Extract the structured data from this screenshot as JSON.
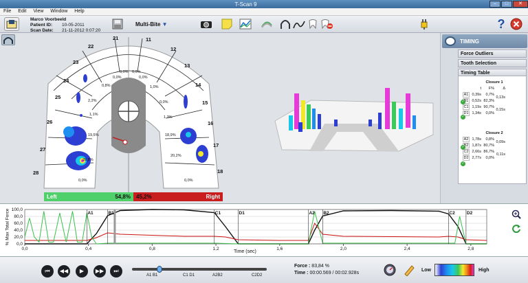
{
  "window": {
    "title": "T-Scan 9"
  },
  "menu": [
    "File",
    "Edit",
    "View",
    "Window",
    "Help"
  ],
  "patient": {
    "name": "Marco Voorbeeld",
    "id_label": "Patient ID:",
    "id": "10-05-2011",
    "date_label": "Scan Date:",
    "date": "21-11-2012 0:07:20"
  },
  "toolbar": {
    "mode": "Multi-Bite"
  },
  "panel": {
    "title": "TIMING",
    "sections": [
      "Force Outliers",
      "Tooth Selection",
      "Timing Table"
    ],
    "headers": {
      "t": "t",
      "f": "F%",
      "d": "Δ"
    },
    "closures": [
      {
        "title": "Closure 1",
        "rows": [
          {
            "id": "A1",
            "t": "0,39s",
            "f": "0,7%"
          },
          {
            "id": "B1",
            "t": "0,52s",
            "f": "82,3%"
          },
          {
            "id": "C1",
            "t": "1,19s",
            "f": "90,7%"
          },
          {
            "id": "D1",
            "t": "1,34s",
            "f": "0,0%"
          }
        ],
        "d1": "0,13s",
        "d2": "0,15s"
      },
      {
        "title": "Closure 2",
        "rows": [
          {
            "id": "A2",
            "t": "1,78s",
            "f": "0,8%"
          },
          {
            "id": "B2",
            "t": "1,87s",
            "f": "80,7%"
          },
          {
            "id": "C2",
            "t": "2,66s",
            "f": "86,7%"
          },
          {
            "id": "D2",
            "t": "2,77s",
            "f": "0,0%"
          }
        ],
        "d1": "0,09s",
        "d2": "0,11s"
      }
    ]
  },
  "arch": {
    "teeth": [
      "21",
      "11",
      "22",
      "12",
      "23",
      "13",
      "24",
      "14",
      "25",
      "15",
      "26",
      "16",
      "27",
      "17",
      "28",
      "18"
    ],
    "percents": [
      "0,0%",
      "0,0%",
      "0,0%",
      "0,0%",
      "0,8%",
      "1,0%",
      "2,2%",
      "0,0%",
      "1,1%",
      "1,3%",
      "19,5%",
      "18,9%",
      "28,8%",
      "20,2%",
      "0,0%",
      "0,0%"
    ],
    "left_label": "Left",
    "left_value": "54,8%",
    "right_label": "Right",
    "right_value": "45,2%"
  },
  "graph": {
    "ylabel": "% Max Total Force",
    "xlabel": "Time (sec)",
    "yticks": [
      "100,0",
      "80,0",
      "60,0",
      "40,0",
      "20,0",
      "0,0"
    ],
    "xticks": [
      "0,0",
      "0,4",
      "0,8",
      "1,2",
      "1,6",
      "2,0",
      "2,4",
      "2,8"
    ],
    "markers": [
      "A1",
      "B1",
      "C1",
      "D1",
      "A2",
      "B2",
      "C2",
      "D2"
    ]
  },
  "timeline": {
    "markers": [
      "A1 B1",
      "C1 D1",
      "A2B2",
      "C2D2"
    ]
  },
  "status": {
    "force_label": "Force :",
    "force_value": "83,84 %",
    "time_label": "Time :",
    "time_value": "00:00.569 / 00:02.928s"
  },
  "legend": {
    "low": "Low",
    "high": "High"
  },
  "colors": {
    "left": "#4fd06a",
    "right": "#c81e1e",
    "black_line": "#111111",
    "red_line": "#cc1111",
    "green_line": "#38c24a"
  },
  "chart_data": {
    "type": "line",
    "xlabel": "Time (sec)",
    "ylabel": "% Max Total Force",
    "xlim": [
      0,
      2.9
    ],
    "ylim": [
      0,
      100
    ],
    "series": [
      {
        "x": [
          0,
          0.39,
          0.45,
          0.52,
          0.6,
          0.8,
          1.0,
          1.19,
          1.26,
          1.34,
          1.6,
          1.78,
          1.82,
          1.87,
          2.0,
          2.3,
          2.6,
          2.66,
          2.72,
          2.77,
          2.9
        ],
        "values": [
          0,
          0,
          30,
          82,
          97,
          100,
          99,
          91,
          50,
          0,
          0,
          0,
          40,
          81,
          96,
          97,
          95,
          87,
          50,
          0,
          0
        ]
      },
      {
        "x": [
          0,
          0.39,
          0.45,
          0.52,
          0.6,
          1.0,
          1.19,
          1.26,
          1.34,
          1.6,
          1.78,
          1.82,
          1.87,
          2.0,
          2.6,
          2.66,
          2.72,
          2.77,
          2.9
        ],
        "values": [
          10,
          10,
          18,
          32,
          28,
          22,
          22,
          20,
          12,
          10,
          10,
          60,
          28,
          22,
          20,
          22,
          20,
          12,
          10
        ]
      },
      {
        "x": [
          0,
          0.03,
          0.06,
          0.09,
          0.12,
          0.15,
          0.18,
          0.22,
          0.26,
          0.3,
          0.33,
          0.36,
          0.39,
          0.42,
          0.45,
          0.52,
          0.6,
          1.2,
          1.34,
          1.78,
          1.82,
          1.87,
          2.7,
          2.73,
          2.77,
          2.9
        ],
        "values": [
          20,
          75,
          20,
          5,
          95,
          5,
          5,
          90,
          5,
          95,
          5,
          5,
          90,
          20,
          0,
          2,
          2,
          2,
          0,
          0,
          95,
          2,
          2,
          80,
          0,
          0
        ]
      }
    ]
  }
}
